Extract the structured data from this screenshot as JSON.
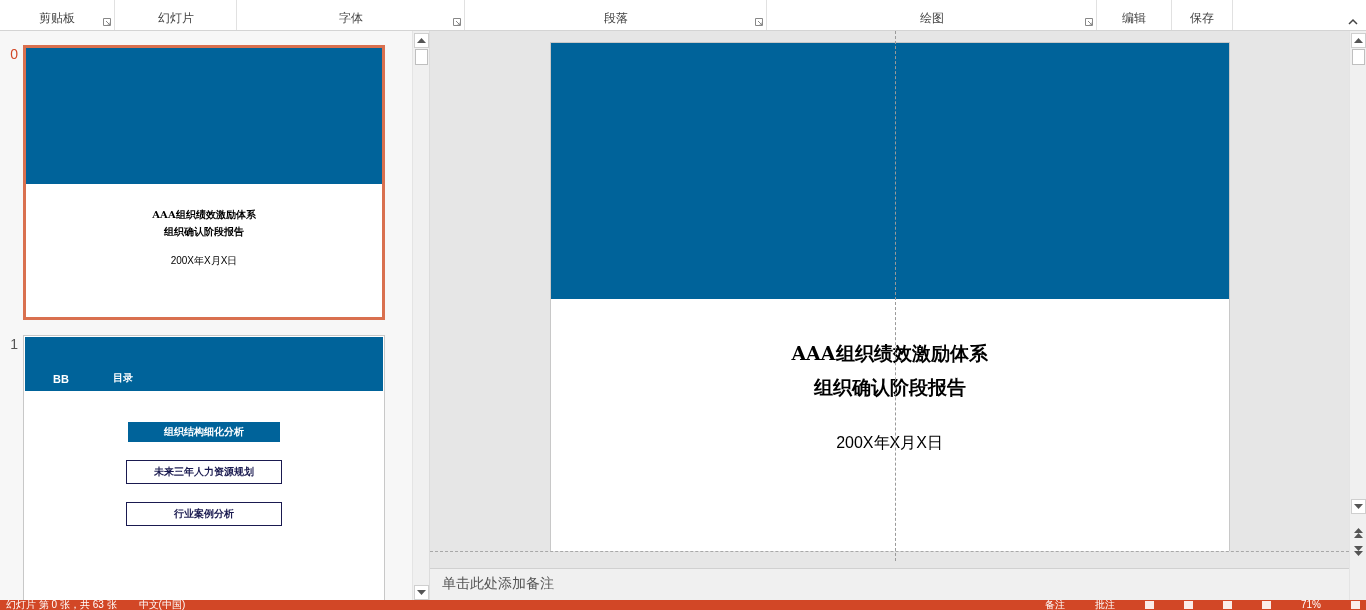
{
  "ribbon": {
    "groups": [
      {
        "label": "剪贴板",
        "launcher": true
      },
      {
        "label": "幻灯片",
        "launcher": false
      },
      {
        "label": "字体",
        "launcher": true
      },
      {
        "label": "段落",
        "launcher": true
      },
      {
        "label": "绘图",
        "launcher": true
      },
      {
        "label": "编辑",
        "launcher": false
      },
      {
        "label": "保存",
        "launcher": false
      }
    ]
  },
  "thumbnails": [
    {
      "number": "0",
      "selected": true,
      "kind": "title",
      "title_lines": [
        "AAA组织绩效激励体系",
        "组织确认阶段报告"
      ],
      "date": "200X年X月X日"
    },
    {
      "number": "1",
      "selected": false,
      "kind": "agenda",
      "header_left": "BB",
      "header_title": "目录",
      "items": [
        {
          "label": "组织结构细化分析",
          "highlighted": true
        },
        {
          "label": "未来三年人力资源规划",
          "highlighted": false
        },
        {
          "label": "行业案例分析",
          "highlighted": false
        }
      ]
    }
  ],
  "slide": {
    "title_lines": [
      "AAA组织绩效激励体系",
      "组织确认阶段报告"
    ],
    "date": "200X年X月X日"
  },
  "notes": {
    "placeholder": "单击此处添加备注"
  },
  "status_bar": {
    "left": [
      "幻灯片 第 0 张，共 63 张",
      "中文(中国)"
    ],
    "right": [
      "备注",
      "批注"
    ],
    "zoom": "71%"
  }
}
